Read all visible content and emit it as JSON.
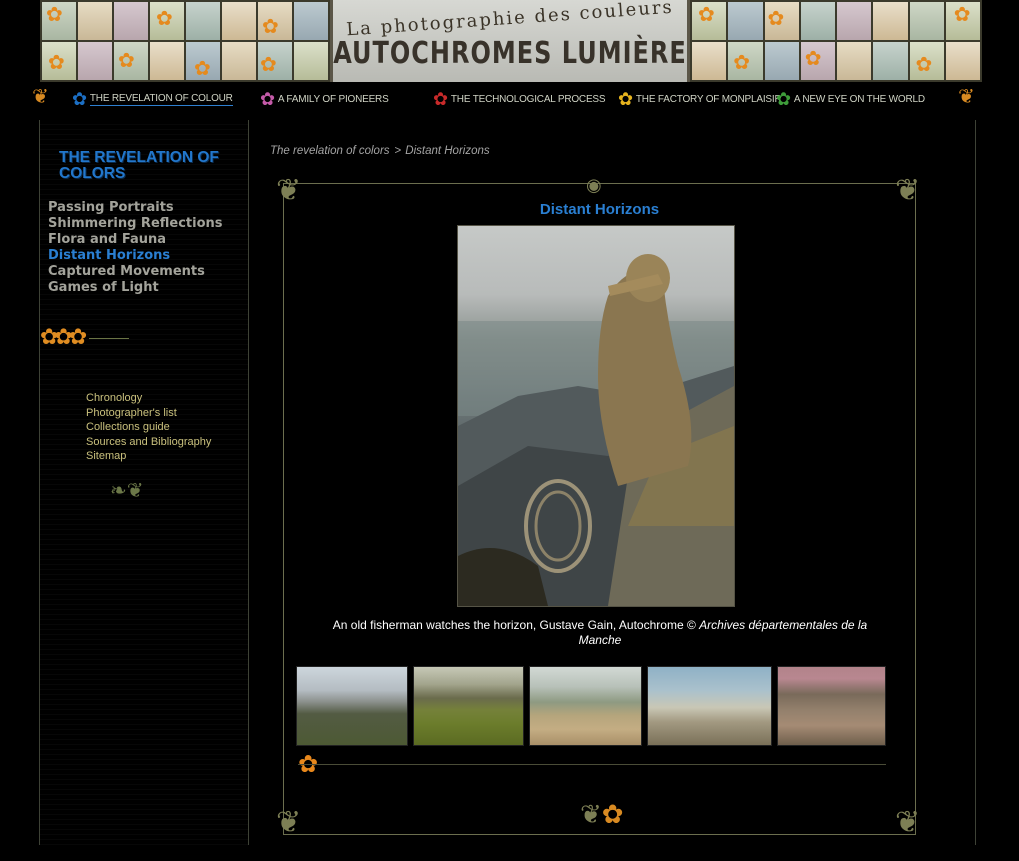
{
  "header": {
    "subtitle": "La photographie des couleurs",
    "title": "AUTOCHROMES LUMIÈRE"
  },
  "nav": {
    "items": [
      {
        "label": "THE REVELATION OF COLOUR",
        "icon": "blue-flower-icon",
        "color": "#1c6fc4",
        "active": true
      },
      {
        "label": "A FAMILY OF PIONEERS",
        "icon": "pink-flower-icon",
        "color": "#c45aa8",
        "active": false
      },
      {
        "label": "THE TECHNOLOGICAL PROCESS",
        "icon": "red-flower-icon",
        "color": "#c82a2a",
        "active": false
      },
      {
        "label": "THE FACTORY OF MONPLAISIR",
        "icon": "yellow-flower-icon",
        "color": "#e6b31e",
        "active": false
      },
      {
        "label": "A NEW EYE ON THE WORLD",
        "icon": "green-flower-icon",
        "color": "#3e9c3a",
        "active": false
      }
    ]
  },
  "sidebar": {
    "section_title": "THE REVELATION OF COLORS",
    "menu": [
      {
        "label": "Passing Portraits",
        "active": false
      },
      {
        "label": "Shimmering Reflections",
        "active": false
      },
      {
        "label": "Flora and Fauna",
        "active": false
      },
      {
        "label": "Distant Horizons",
        "active": true
      },
      {
        "label": "Captured Movements",
        "active": false
      },
      {
        "label": "Games of Light",
        "active": false
      }
    ],
    "links": [
      "Chronology",
      "Photographer's list",
      "Collections guide",
      "Sources and Bibliography",
      "Sitemap"
    ]
  },
  "breadcrumb": {
    "parent": "The revelation of colors",
    "separator": ">",
    "current": "Distant Horizons"
  },
  "main": {
    "photo_title": "Distant Horizons",
    "caption_plain": "An old fisherman watches the horizon, Gustave Gain, Autochrome © ",
    "caption_italic": "Archives départementales de la Manche",
    "thumbnail_count": 5
  },
  "colors": {
    "accent_blue": "#2a7fd2",
    "ornament_orange": "#e0881e",
    "link_gold": "#c9c07d",
    "menu_grey": "#a3a39b"
  }
}
